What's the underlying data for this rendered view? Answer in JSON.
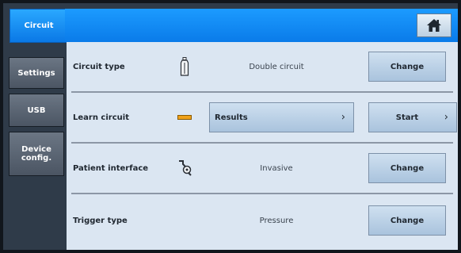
{
  "nav": {
    "tabs": [
      {
        "label": "Circuit",
        "active": true
      },
      {
        "label": "Settings",
        "active": false
      },
      {
        "label": "USB",
        "active": false
      },
      {
        "label": "Device config.",
        "active": false
      }
    ]
  },
  "header": {
    "home_icon": "home-icon"
  },
  "rows": [
    {
      "label": "Circuit type",
      "icon": "bottle-icon",
      "value": "Double circuit",
      "button": "Change"
    },
    {
      "label": "Learn circuit",
      "icon": "orange-bar-icon",
      "results_button": "Results",
      "start_button": "Start"
    },
    {
      "label": "Patient interface",
      "icon": "hose-connector-icon",
      "value": "Invasive",
      "button": "Change"
    },
    {
      "label": "Trigger type",
      "value": "Pressure",
      "button": "Change"
    }
  ],
  "colors": {
    "accent": "#0a7be9",
    "panel": "#dbe6f2",
    "button": "#bcd2e8"
  }
}
